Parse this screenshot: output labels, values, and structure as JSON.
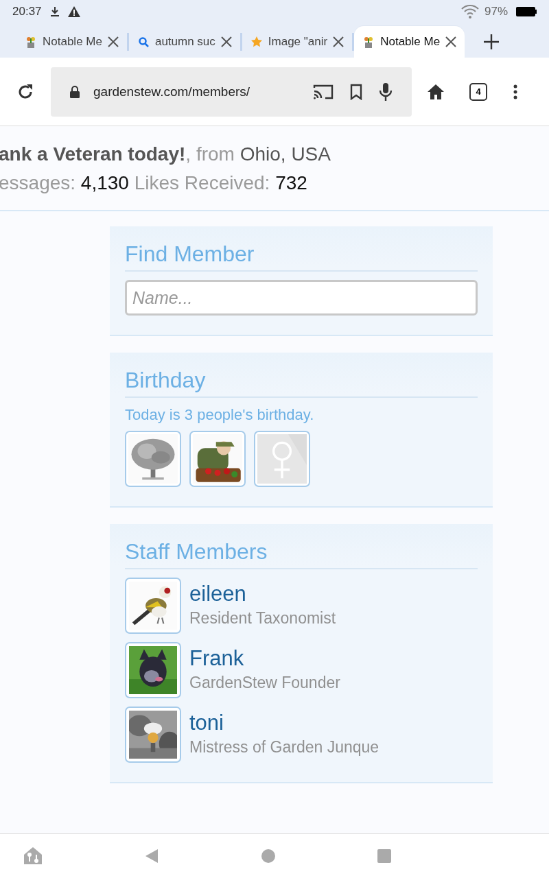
{
  "status_bar": {
    "time": "20:37",
    "battery": "97%"
  },
  "tabs": [
    {
      "title": "Notable Me",
      "kind": "plant",
      "selected": false
    },
    {
      "title": "autumn suc",
      "kind": "search",
      "selected": false
    },
    {
      "title": "Image \"anir",
      "kind": "star",
      "selected": false
    },
    {
      "title": "Notable Me",
      "kind": "plant",
      "selected": true
    }
  ],
  "address_bar": {
    "url": "gardenstew.com/members/",
    "tab_count": "4"
  },
  "profile": {
    "signature": "ank a Veteran today!",
    "from_label": ", from",
    "location": "Ohio, USA",
    "stats": [
      {
        "label": "essages:",
        "value": "4,130"
      },
      {
        "label": "Likes Received:",
        "value": "732"
      }
    ]
  },
  "find_member": {
    "title": "Find Member",
    "placeholder": "Name..."
  },
  "birthday": {
    "title": "Birthday",
    "text": "Today is 3 people's birthday.",
    "avatars": [
      {
        "kind": "picture"
      },
      {
        "kind": "picture"
      },
      {
        "kind": "default-female"
      }
    ]
  },
  "staff": {
    "title": "Staff Members",
    "members": [
      {
        "name": "eileen",
        "title": "Resident Taxonomist"
      },
      {
        "name": "Frank",
        "title": "GardenStew Founder"
      },
      {
        "name": "toni",
        "title": "Mistress of Garden Junque"
      }
    ]
  }
}
